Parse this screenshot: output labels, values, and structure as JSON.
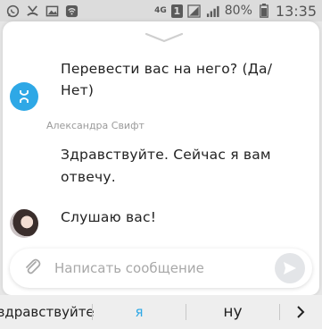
{
  "status_bar": {
    "network": "4G",
    "sim_number": "1",
    "battery": "80%",
    "time": "13:35",
    "icons": [
      "whatsapp-icon",
      "missed-call-icon",
      "gallery-icon",
      "wifi-icon",
      "sim-icon",
      "signal-icon",
      "battery-icon"
    ]
  },
  "chat": {
    "messages": [
      {
        "sender": "",
        "text_line1": "Перевести вас на него? (Да/",
        "text_line2": "Нет)",
        "avatar": "bot-avatar"
      },
      {
        "sender": "Александра Свифт",
        "text_line1": "Здравствуйте. Сейчас я вам",
        "text_line2": "отвечу."
      },
      {
        "sender": "",
        "text_line1": "Слушаю вас!",
        "avatar": "user-avatar"
      }
    ]
  },
  "composer": {
    "placeholder": "Написать сообщение",
    "attach_icon": "paperclip-icon",
    "send_icon": "send-icon"
  },
  "keyboard_suggestions": {
    "items": [
      "здравствуйте",
      "я",
      "ну"
    ],
    "highlight_color": "#2ea8e6",
    "more_icon": "chevron-right-icon"
  },
  "colors": {
    "accent": "#2ea8e6"
  }
}
